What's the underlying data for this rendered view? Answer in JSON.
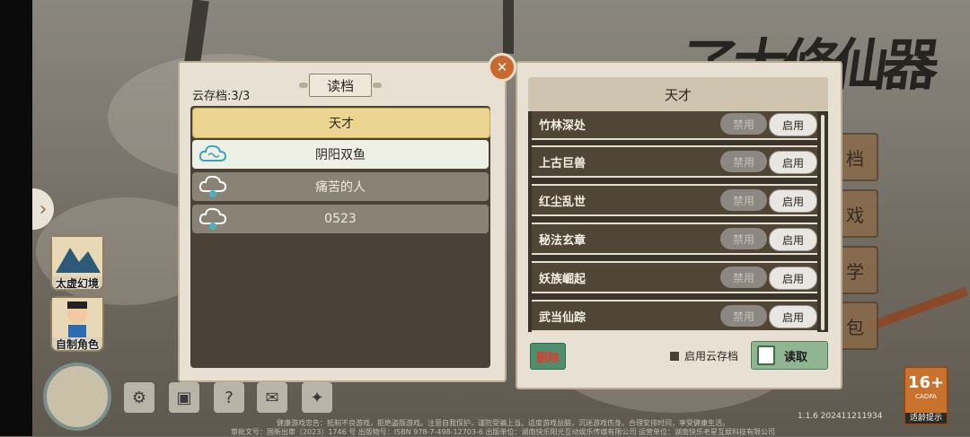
{
  "left_panel": {
    "cloud_count": "云存档:3/3",
    "tab_label": "读档",
    "saves": [
      {
        "label": "天才",
        "style": "active",
        "icon": "none"
      },
      {
        "label": "阴阳双鱼",
        "style": "light",
        "icon": "cloud-icon"
      },
      {
        "label": "痛苦的人",
        "style": "dark",
        "icon": "cloud-upload-icon"
      },
      {
        "label": "0523",
        "style": "dark",
        "icon": "cloud-upload-icon"
      }
    ]
  },
  "right_panel": {
    "title": "天才",
    "mods": [
      {
        "name": "竹林深处",
        "disable": "禁用",
        "enable": "启用"
      },
      {
        "name": "上古巨兽",
        "disable": "禁用",
        "enable": "启用"
      },
      {
        "name": "红尘乱世",
        "disable": "禁用",
        "enable": "启用"
      },
      {
        "name": "秘法玄章",
        "disable": "禁用",
        "enable": "启用"
      },
      {
        "name": "妖族崛起",
        "disable": "禁用",
        "enable": "启用"
      },
      {
        "name": "武当仙踪",
        "disable": "禁用",
        "enable": "启用"
      }
    ],
    "delete_label": "删除",
    "cloud_toggle_label": "启用云存档",
    "load_label": "读取"
  },
  "side_buttons": [
    {
      "label": "太虚幻境"
    },
    {
      "label": "自制角色"
    }
  ],
  "right_menu_fragments": [
    "档",
    "戏",
    "学",
    "包"
  ],
  "title_art": "了大修仙器",
  "version": "1.1.6 202411211934",
  "rating": {
    "age": "16+",
    "org": "CADPA",
    "tip": "适龄提示"
  },
  "footer": {
    "line1": "健康游戏忠告：抵制不良游戏，拒绝盗版游戏。注意自我保护，谨防受骗上当。适度游戏益脑，沉迷游戏伤身。合理安排时间，享受健康生活。",
    "line2": "审批文号：国新出审〔2023〕1746 号 出版物号：ISBN 978-7-498-12703-6 出版单位：湖南快乐阳光互动娱乐传媒有限公司 运营单位：湖南快乐老星互娱科技有限公司"
  },
  "colors": {
    "panel_bg": "#e8e1d3",
    "list_bg": "#3b342b",
    "active_save": "#ecd590",
    "close_btn": "#c8692f",
    "load_btn": "#8fb592",
    "delete_btn": "#4f8f6e"
  }
}
